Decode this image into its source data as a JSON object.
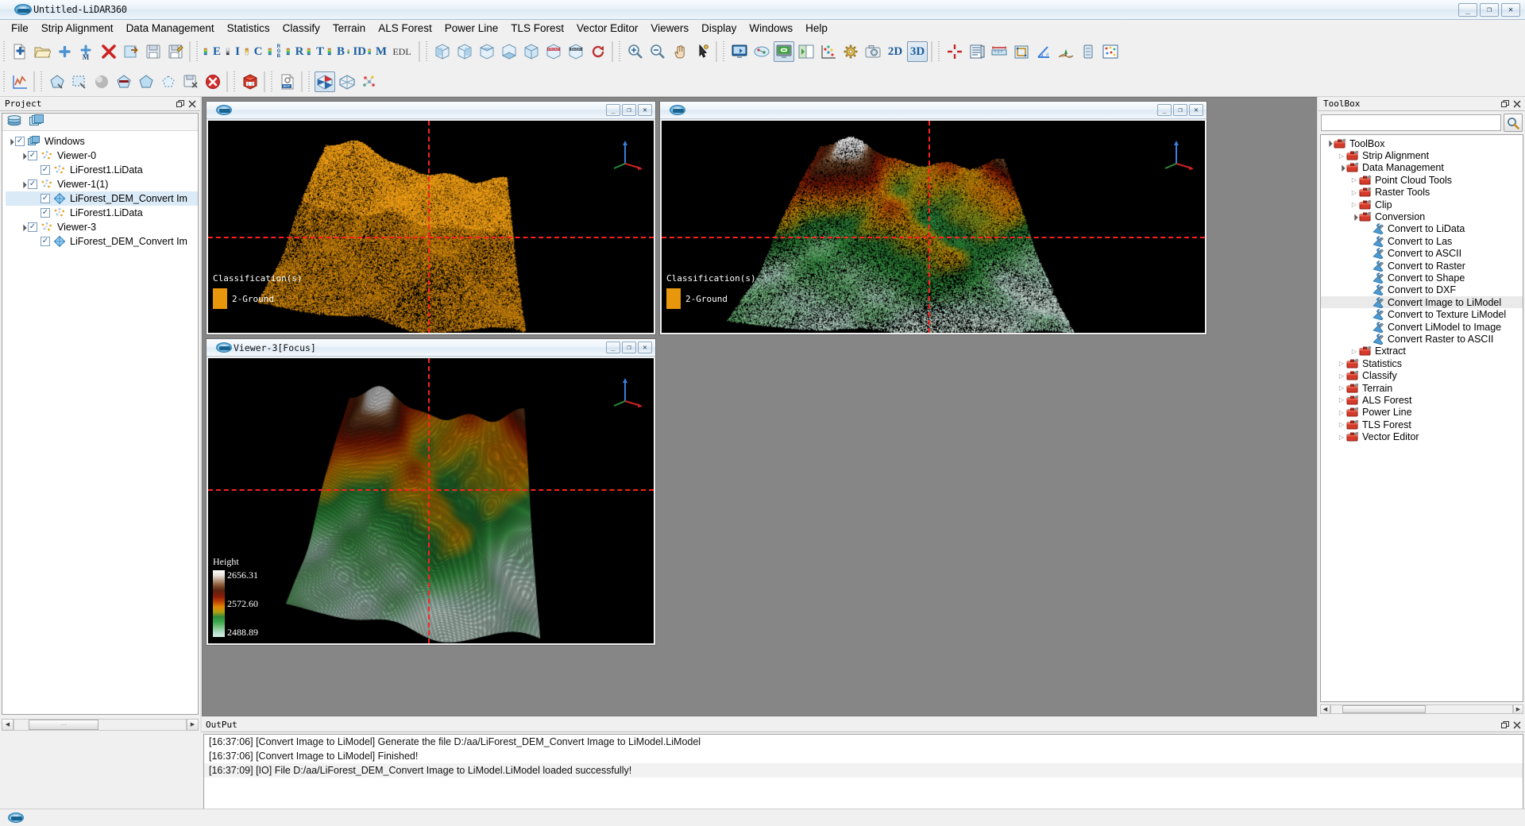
{
  "window": {
    "title": "Untitled-LiDAR360",
    "minimize": "_",
    "maximize": "❐",
    "close": "✕"
  },
  "menubar": {
    "items": [
      "File",
      "Strip Alignment",
      "Data Management",
      "Statistics",
      "Classify",
      "Terrain",
      "ALS Forest",
      "Power Line",
      "TLS Forest",
      "Vector Editor",
      "Viewers",
      "Display",
      "Windows",
      "Help"
    ]
  },
  "toolbar_row1": {
    "groups": [
      {
        "name": "file-group",
        "buttons": [
          {
            "icon": "new-file-icon",
            "label": ""
          },
          {
            "icon": "open-folder-icon",
            "label": ""
          },
          {
            "icon": "add-data-icon",
            "label": ""
          },
          {
            "icon": "add-multiple-icon",
            "label": ""
          },
          {
            "icon": "remove-data-icon",
            "label": ""
          },
          {
            "icon": "export-icon",
            "label": ""
          },
          {
            "icon": "save-icon",
            "label": ""
          },
          {
            "icon": "save-as-icon",
            "label": ""
          }
        ]
      },
      {
        "name": "display-by-group",
        "buttons": [
          {
            "icon": "ramp-icon",
            "label": "E"
          },
          {
            "icon": "ramp-gray-icon",
            "label": "I"
          },
          {
            "icon": "ramp-class-icon",
            "label": "C"
          },
          {
            "icon": "ramp-rgb-icon",
            "label": "RGB"
          },
          {
            "icon": "ramp-return-icon",
            "label": "R"
          },
          {
            "icon": "ramp-time-icon",
            "label": "T"
          },
          {
            "icon": "ramp-blend-icon",
            "label": "B"
          },
          {
            "icon": "ramp-id-icon",
            "label": "ID"
          },
          {
            "icon": "ramp-model-icon",
            "label": "M"
          },
          {
            "icon": "edl-icon",
            "label": "EDL"
          }
        ]
      },
      {
        "name": "view-cube-group",
        "buttons": [
          {
            "icon": "view-left-icon",
            "label": ""
          },
          {
            "icon": "view-right-icon",
            "label": ""
          },
          {
            "icon": "view-top-icon",
            "label": ""
          },
          {
            "icon": "view-bottom-icon",
            "label": ""
          },
          {
            "icon": "view-iso-icon",
            "label": ""
          },
          {
            "icon": "view-front-icon",
            "label": "FRONT"
          },
          {
            "icon": "view-back-icon",
            "label": "BACK"
          },
          {
            "icon": "rotate-view-icon",
            "label": ""
          }
        ]
      },
      {
        "name": "navigate-group",
        "buttons": [
          {
            "icon": "zoom-in-icon",
            "label": ""
          },
          {
            "icon": "zoom-out-icon",
            "label": ""
          },
          {
            "icon": "pan-icon",
            "label": ""
          },
          {
            "icon": "pick-point-icon",
            "label": ""
          }
        ]
      },
      {
        "name": "window-group",
        "buttons": [
          {
            "icon": "window-sync-icon",
            "label": ""
          },
          {
            "icon": "link-views-icon",
            "label": ""
          },
          {
            "icon": "linked-window-icon",
            "label": "",
            "selected": true
          },
          {
            "icon": "split-window-icon",
            "label": ""
          },
          {
            "icon": "scatter-axes-icon",
            "label": ""
          },
          {
            "icon": "settings-gear-icon",
            "label": ""
          },
          {
            "icon": "snapshot-icon",
            "label": ""
          },
          {
            "icon": "view-2d-icon",
            "label": "2D"
          },
          {
            "icon": "view-3d-icon",
            "label": "3D",
            "selected": true
          }
        ]
      },
      {
        "name": "measure-group",
        "buttons": [
          {
            "icon": "crosshair-icon",
            "label": ""
          },
          {
            "icon": "profile-icon",
            "label": ""
          },
          {
            "icon": "measure-length-icon",
            "label": ""
          },
          {
            "icon": "measure-area-icon",
            "label": ""
          },
          {
            "icon": "measure-angle-icon",
            "label": ""
          },
          {
            "icon": "measure-height-icon",
            "label": ""
          },
          {
            "icon": "measure-volume-icon",
            "label": ""
          },
          {
            "icon": "density-icon",
            "label": ""
          }
        ]
      }
    ]
  },
  "toolbar_row2": {
    "groups": [
      {
        "name": "plot-group",
        "buttons": [
          {
            "icon": "chart-icon"
          }
        ]
      },
      {
        "name": "selection-group",
        "buttons": [
          {
            "icon": "polygon-select-icon"
          },
          {
            "icon": "rect-select-icon"
          },
          {
            "icon": "sphere-select-icon"
          },
          {
            "icon": "clip-inside-icon"
          },
          {
            "icon": "clip-outside-icon"
          },
          {
            "icon": "clip-polygon-icon"
          },
          {
            "icon": "save-selection-icon"
          },
          {
            "icon": "cancel-selection-icon"
          }
        ]
      },
      {
        "name": "batch-group",
        "buttons": [
          {
            "icon": "batch-123-icon"
          }
        ]
      },
      {
        "name": "bat-group",
        "buttons": [
          {
            "icon": "bat-script-icon"
          }
        ]
      },
      {
        "name": "tin-group",
        "buttons": [
          {
            "icon": "tin-filled-icon",
            "selected": true
          },
          {
            "icon": "tin-wire-icon"
          },
          {
            "icon": "points-icon"
          }
        ]
      }
    ]
  },
  "project_panel": {
    "title": "Project",
    "float_icon": "float-icon",
    "close_icon": "close-icon",
    "toolbar": [
      {
        "icon": "layers-icon"
      },
      {
        "icon": "windows-stack-icon"
      }
    ],
    "tree": [
      {
        "label": "Windows",
        "indent": 0,
        "arrow": "down",
        "checked": true,
        "icon": "windows-stack-icon",
        "selected": false
      },
      {
        "label": "Viewer-0",
        "indent": 1,
        "arrow": "down",
        "checked": true,
        "icon": "pointcloud-icon",
        "selected": false
      },
      {
        "label": "LiForest1.LiData",
        "indent": 2,
        "arrow": "blank",
        "checked": true,
        "icon": "pointcloud-icon",
        "selected": false
      },
      {
        "label": "Viewer-1(1)",
        "indent": 1,
        "arrow": "down",
        "checked": true,
        "icon": "pointcloud-icon",
        "selected": false
      },
      {
        "label": "LiForest_DEM_Convert Im",
        "indent": 2,
        "arrow": "blank",
        "checked": true,
        "icon": "model-icon",
        "selected": true
      },
      {
        "label": "LiForest1.LiData",
        "indent": 2,
        "arrow": "blank",
        "checked": true,
        "icon": "pointcloud-icon",
        "selected": false
      },
      {
        "label": "Viewer-3",
        "indent": 1,
        "arrow": "down",
        "checked": true,
        "icon": "pointcloud-icon",
        "selected": false
      },
      {
        "label": "LiForest_DEM_Convert Im",
        "indent": 2,
        "arrow": "blank",
        "checked": true,
        "icon": "model-icon",
        "selected": false
      }
    ],
    "scrollbar": {
      "left_arrow": "◀",
      "right_arrow": "▶",
      "thumb_grip": "⋯"
    }
  },
  "toolbox_panel": {
    "title": "ToolBox",
    "float_icon": "float-icon",
    "close_icon": "close-icon",
    "search_placeholder": "",
    "search_value": "",
    "search_icon": "search-icon",
    "tree": [
      {
        "label": "ToolBox",
        "indent": 0,
        "arrow": "down",
        "icon": "toolbox-icon",
        "selected": false
      },
      {
        "label": "Strip Alignment",
        "indent": 1,
        "arrow": "right",
        "icon": "toolbox-icon",
        "selected": false
      },
      {
        "label": "Data Management",
        "indent": 1,
        "arrow": "down",
        "icon": "toolbox-icon",
        "selected": false
      },
      {
        "label": "Point Cloud Tools",
        "indent": 2,
        "arrow": "right",
        "icon": "toolbox-icon",
        "selected": false
      },
      {
        "label": "Raster Tools",
        "indent": 2,
        "arrow": "right",
        "icon": "toolbox-icon",
        "selected": false
      },
      {
        "label": "Clip",
        "indent": 2,
        "arrow": "right",
        "icon": "toolbox-icon",
        "selected": false
      },
      {
        "label": "Conversion",
        "indent": 2,
        "arrow": "down",
        "icon": "toolbox-icon",
        "selected": false
      },
      {
        "label": "Convert to LiData",
        "indent": 3,
        "arrow": "blank",
        "icon": "tool-icon",
        "selected": false
      },
      {
        "label": "Convert to Las",
        "indent": 3,
        "arrow": "blank",
        "icon": "tool-icon",
        "selected": false
      },
      {
        "label": "Convert to ASCII",
        "indent": 3,
        "arrow": "blank",
        "icon": "tool-icon",
        "selected": false
      },
      {
        "label": "Convert to Raster",
        "indent": 3,
        "arrow": "blank",
        "icon": "tool-icon",
        "selected": false
      },
      {
        "label": "Convert to Shape",
        "indent": 3,
        "arrow": "blank",
        "icon": "tool-icon",
        "selected": false
      },
      {
        "label": "Convert to DXF",
        "indent": 3,
        "arrow": "blank",
        "icon": "tool-icon",
        "selected": false
      },
      {
        "label": "Convert Image to LiModel",
        "indent": 3,
        "arrow": "blank",
        "icon": "tool-icon",
        "selected": true
      },
      {
        "label": "Convert to Texture LiModel",
        "indent": 3,
        "arrow": "blank",
        "icon": "tool-icon",
        "selected": false
      },
      {
        "label": "Convert LiModel to Image",
        "indent": 3,
        "arrow": "blank",
        "icon": "tool-icon",
        "selected": false
      },
      {
        "label": "Convert Raster to ASCII",
        "indent": 3,
        "arrow": "blank",
        "icon": "tool-icon",
        "selected": false
      },
      {
        "label": "Extract",
        "indent": 2,
        "arrow": "right",
        "icon": "toolbox-icon",
        "selected": false
      },
      {
        "label": "Statistics",
        "indent": 1,
        "arrow": "right",
        "icon": "toolbox-icon",
        "selected": false
      },
      {
        "label": "Classify",
        "indent": 1,
        "arrow": "right",
        "icon": "toolbox-icon",
        "selected": false
      },
      {
        "label": "Terrain",
        "indent": 1,
        "arrow": "right",
        "icon": "toolbox-icon",
        "selected": false
      },
      {
        "label": "ALS Forest",
        "indent": 1,
        "arrow": "right",
        "icon": "toolbox-icon",
        "selected": false
      },
      {
        "label": "Power Line",
        "indent": 1,
        "arrow": "right",
        "icon": "toolbox-icon",
        "selected": false
      },
      {
        "label": "TLS Forest",
        "indent": 1,
        "arrow": "right",
        "icon": "toolbox-icon",
        "selected": false
      },
      {
        "label": "Vector Editor",
        "indent": 1,
        "arrow": "right",
        "icon": "toolbox-icon",
        "selected": false
      }
    ],
    "scrollbar": {
      "left_arrow": "◀",
      "right_arrow": "▶",
      "thumb_grip": "⋯"
    }
  },
  "viewers": [
    {
      "id": "viewer-0",
      "name": "",
      "minimize": "_",
      "maximize": "❐",
      "close": "✕",
      "legend": {
        "title": "Classification(s)",
        "swatch_color": "#E8960C",
        "entry": "2-Ground"
      },
      "render": "orange-point-cloud"
    },
    {
      "id": "viewer-1",
      "name": "",
      "minimize": "_",
      "maximize": "❐",
      "close": "✕",
      "legend": {
        "title": "Classification(s)",
        "swatch_color": "#E8960C",
        "entry": "2-Ground"
      },
      "render": "mixed-point-cloud"
    },
    {
      "id": "viewer-3",
      "name": "Viewer-3[Focus]",
      "minimize": "_",
      "maximize": "❐",
      "close": "✕",
      "height_legend": {
        "title": "Height",
        "max": "2656.31",
        "mid": "2572.60",
        "min": "2488.89"
      },
      "render": "dem-surface"
    }
  ],
  "output_panel": {
    "title": "OutPut",
    "float_icon": "float-icon",
    "close_icon": "close-icon",
    "lines": [
      "[16:37:06] [Convert Image to LiModel]    Generate the file D:/aa/LiForest_DEM_Convert Image to LiModel.LiModel",
      "[16:37:06] [Convert Image to LiModel]    Finished!",
      "[16:37:09] [IO]    File D:/aa/LiForest_DEM_Convert Image to LiModel.LiModel loaded successfully!"
    ]
  },
  "statusbar": {
    "logo": "app-logo-icon"
  },
  "colors": {
    "accent": "#1d6fa8",
    "crosshair": "#ff2020",
    "ground_class": "#E8960C",
    "selection": "#dbeaf7"
  }
}
